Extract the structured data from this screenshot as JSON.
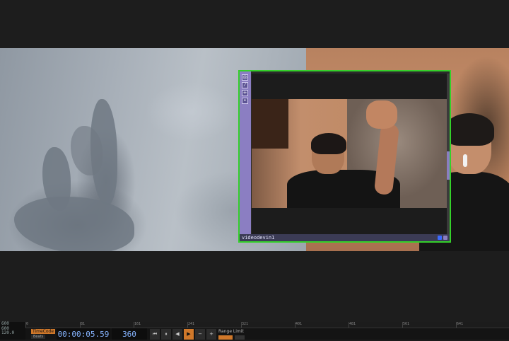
{
  "node": {
    "name": "videodevin1",
    "sidebar_icons": [
      "viewer-icon",
      "wand-icon",
      "plus-icon",
      "pin-icon"
    ],
    "border_color": "#34d02a",
    "flag_colors": [
      "#3b6bff",
      "#8b7ec2"
    ]
  },
  "timeline": {
    "side_values": [
      "600",
      "600",
      "120.0"
    ],
    "ruler_ticks": [
      "0",
      "81",
      "161",
      "241",
      "321",
      "401",
      "481",
      "561",
      "641"
    ],
    "timecode_label": "TimeCode",
    "beats_label": "Beats",
    "timecode": "00:00:05.59",
    "frame": "360",
    "buttons": [
      {
        "name": "rewind-button",
        "glyph": "⏮"
      },
      {
        "name": "pause-button",
        "glyph": "⏸"
      },
      {
        "name": "step-back-button",
        "glyph": "◀"
      },
      {
        "name": "play-button",
        "glyph": "▶"
      },
      {
        "name": "minus-button",
        "glyph": "−"
      },
      {
        "name": "plus-button",
        "glyph": "+"
      }
    ],
    "range_limit_label": "Range Limit",
    "accent_color": "#d0782a",
    "timecode_color": "#86b4ff"
  }
}
